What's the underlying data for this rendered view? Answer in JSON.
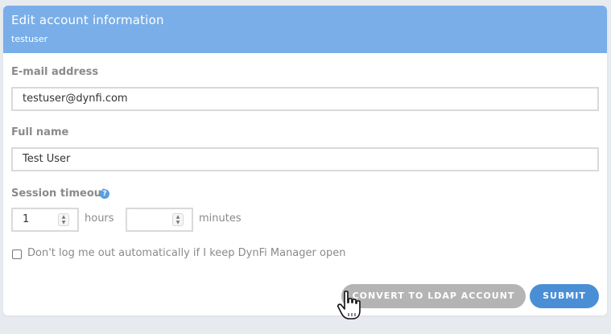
{
  "header": {
    "title": "Edit account information",
    "subtitle": "testuser"
  },
  "form": {
    "email": {
      "label": "E-mail address",
      "value": "testuser@dynfi.com"
    },
    "fullname": {
      "label": "Full name",
      "value": "Test User"
    },
    "session_timeout": {
      "label": "Session timeout",
      "help_icon": "question-circle-icon",
      "hours_value": "1",
      "hours_unit": "hours",
      "minutes_value": "",
      "minutes_unit": "minutes"
    },
    "keep_logged_in": {
      "label": "Don't log me out automatically if I keep DynFi Manager open",
      "checked": false
    }
  },
  "buttons": {
    "convert_label": "CONVERT TO LDAP ACCOUNT",
    "submit_label": "SUBMIT"
  },
  "colors": {
    "header_bg": "#7aaee8",
    "submit_bg": "#4a8fd6",
    "convert_bg": "#b4b4b4",
    "page_bg": "#e7ebf0"
  },
  "cursor_icon": "hand-pointer-icon"
}
